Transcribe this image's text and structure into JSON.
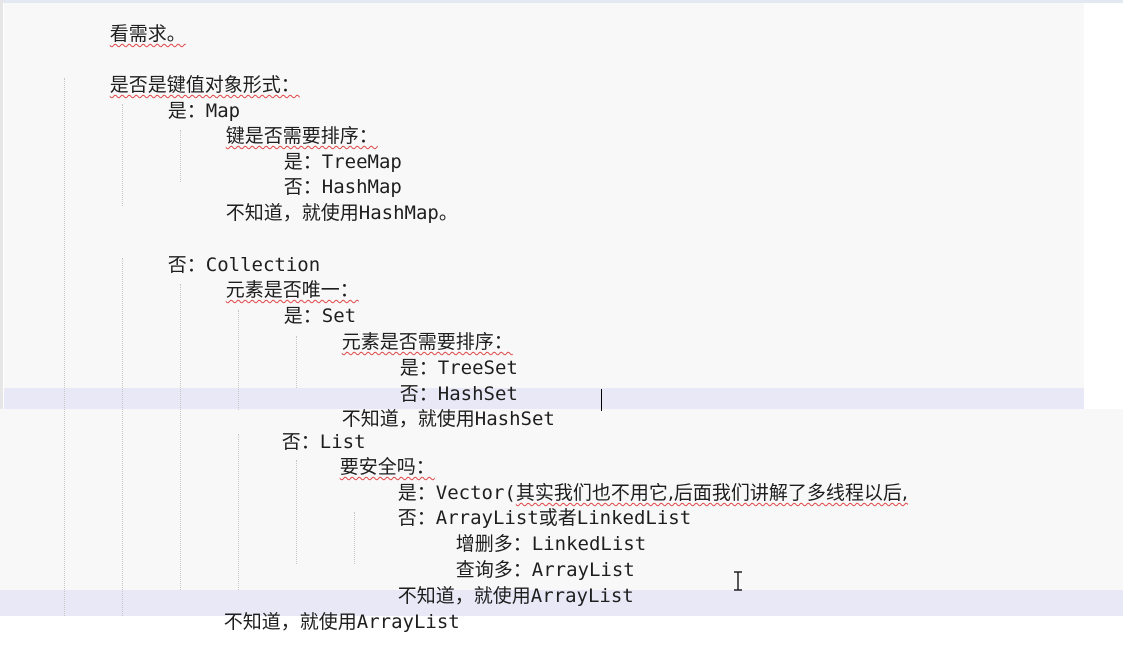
{
  "lines": [
    {
      "pre": "",
      "zh": "看需求。",
      "en": ""
    },
    {
      "pre": "",
      "zh": "是否是键值对象形式：",
      "en": ""
    },
    {
      "pre": "是：",
      "zh": "",
      "en": "Map"
    },
    {
      "pre": "",
      "zh": "键是否需要排序：",
      "en": ""
    },
    {
      "pre": "是：",
      "zh": "",
      "en": "TreeMap"
    },
    {
      "pre": "否：",
      "zh": "",
      "en": "HashMap"
    },
    {
      "pre": "不知道，就使用",
      "zh": "",
      "en": "HashMap。"
    },
    {
      "pre": "否：",
      "zh": "",
      "en": "Collection"
    },
    {
      "pre": "",
      "zh": "元素是否唯一：",
      "en": ""
    },
    {
      "pre": "是：",
      "zh": "",
      "en": "Set"
    },
    {
      "pre": "",
      "zh": "元素是否需要排序：",
      "en": ""
    },
    {
      "pre": "是：",
      "zh": "",
      "en": "TreeSet"
    },
    {
      "pre": "否：",
      "zh": "",
      "en": "HashSet"
    },
    {
      "pre": "不知道，就使用",
      "zh": "",
      "en": "HashSet"
    },
    {
      "pre": "否：",
      "zh": "",
      "en": "List"
    },
    {
      "pre": "",
      "zh": "要安全吗：",
      "en": ""
    },
    {
      "pre": "是：",
      "en": "Vector(",
      "zh": "其实我们也不用它,后面我们讲解了多线程以后,"
    },
    {
      "pre": "否：",
      "en": "ArrayList",
      "zh2": "或者",
      "en2": "LinkedList"
    },
    {
      "pre": "增删多：",
      "zh": "",
      "en": "LinkedList"
    },
    {
      "pre": "查询多：",
      "zh": "",
      "en": "ArrayList"
    },
    {
      "pre": "不知道，就使用",
      "zh": "",
      "en": "ArrayList"
    },
    {
      "pre": "不知道，就使用",
      "zh": "",
      "en": "ArrayList"
    }
  ],
  "icons": {
    "cursor": "text-ibeam-cursor-icon"
  }
}
